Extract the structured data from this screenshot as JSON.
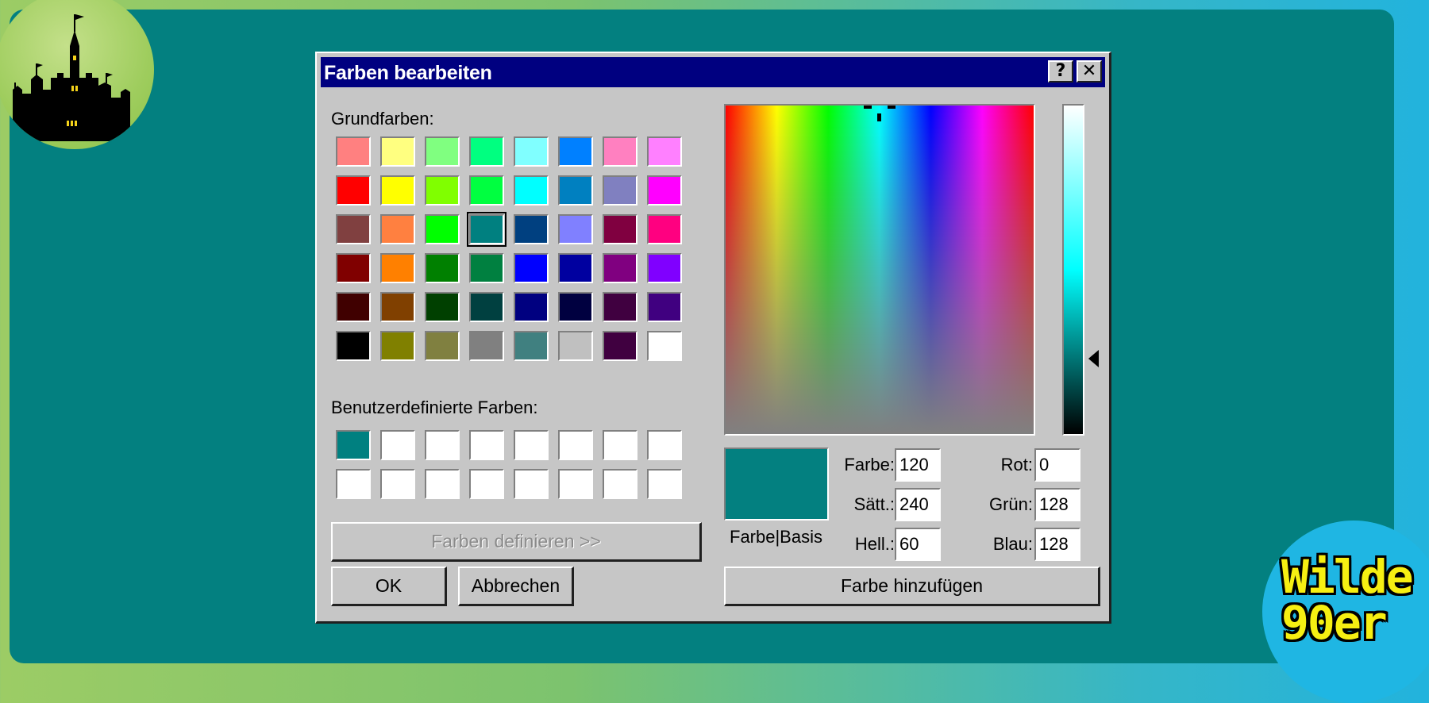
{
  "colors": {
    "desktop": "#038080",
    "titlebar": "#000080",
    "dialog_bg": "#c6c6c6"
  },
  "logos": {
    "wilde_line1": "Wilde",
    "wilde_line2": "90er"
  },
  "dialog": {
    "title": "Farben bearbeiten",
    "help_glyph": "?",
    "close_glyph": "✕",
    "basic_colors_label": "Grundfarben:",
    "custom_colors_label": "Benutzerdefinierte Farben:",
    "define_button": "Farben definieren >>",
    "ok_button": "OK",
    "cancel_button": "Abbrechen",
    "add_button": "Farbe hinzufügen",
    "preview_label": "Farbe|Basis",
    "hue_label": "Farbe:",
    "hue_value": "120",
    "sat_label": "Sätt.:",
    "sat_value": "240",
    "lum_label": "Hell.:",
    "lum_value": "60",
    "red_label": "Rot:",
    "red_value": "0",
    "green_label": "Grün:",
    "green_value": "128",
    "blue_label": "Blau:",
    "blue_value": "128",
    "selected_basic_index": 19,
    "basic_colors": [
      "#ff8080",
      "#ffff80",
      "#80ff80",
      "#00ff80",
      "#80ffff",
      "#0080ff",
      "#ff80c0",
      "#ff80ff",
      "#ff0000",
      "#ffff00",
      "#80ff00",
      "#00ff40",
      "#00ffff",
      "#0080c0",
      "#8080c0",
      "#ff00ff",
      "#804040",
      "#ff8040",
      "#00ff00",
      "#008080",
      "#004080",
      "#8080ff",
      "#800040",
      "#ff0080",
      "#800000",
      "#ff8000",
      "#008000",
      "#008040",
      "#0000ff",
      "#0000a0",
      "#800080",
      "#8000ff",
      "#400000",
      "#804000",
      "#004000",
      "#004040",
      "#000080",
      "#000040",
      "#400040",
      "#400080",
      "#000000",
      "#808000",
      "#808040",
      "#808080",
      "#408080",
      "#c0c0c0",
      "#400040",
      "#ffffff"
    ],
    "custom_colors": [
      "#008080",
      "#ffffff",
      "#ffffff",
      "#ffffff",
      "#ffffff",
      "#ffffff",
      "#ffffff",
      "#ffffff",
      "#ffffff",
      "#ffffff",
      "#ffffff",
      "#ffffff",
      "#ffffff",
      "#ffffff",
      "#ffffff",
      "#ffffff"
    ]
  }
}
